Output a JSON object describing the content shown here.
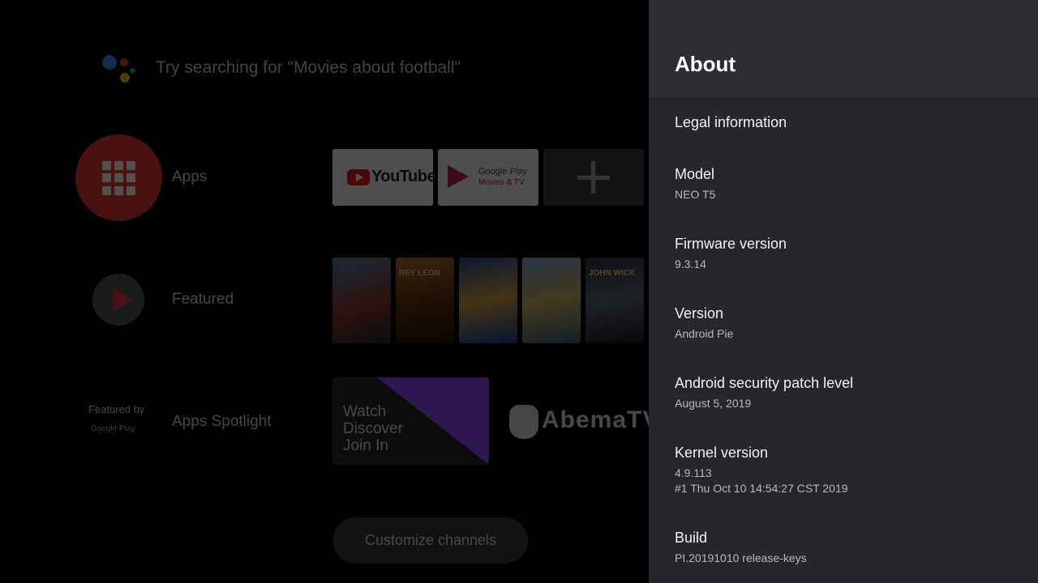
{
  "home": {
    "search_hint": "Try searching for \"Movies about football\"",
    "rows": {
      "apps_label": "Apps",
      "featured_label": "Featured",
      "spotlight_label": "Apps Spotlight",
      "featured_by": "Featured by",
      "featured_by_logo": "Google Play"
    },
    "apps": {
      "youtube": "YouTube",
      "play_movies_line1": "Google Play",
      "play_movies_line2": "Movies & TV"
    },
    "posters": [
      "",
      "REY LEÓN",
      "",
      "",
      "JOHN WICK"
    ],
    "twitch_text": "Watch\nDiscover\nJoin In",
    "abema": "AbemaTV",
    "customize": "Customize channels",
    "colors": {
      "apps_red": "#e53935",
      "twitch_purple": "#9146ff"
    }
  },
  "panel": {
    "title": "About",
    "items": [
      {
        "title": "Legal information",
        "sub": []
      },
      {
        "title": "Model",
        "sub": [
          "NEO T5"
        ]
      },
      {
        "title": "Firmware version",
        "sub": [
          "9.3.14"
        ]
      },
      {
        "title": "Version",
        "sub": [
          "Android Pie"
        ]
      },
      {
        "title": "Android security patch level",
        "sub": [
          "August 5, 2019"
        ]
      },
      {
        "title": "Kernel version",
        "sub": [
          "4.9.113",
          "#1 Thu Oct 10 14:54:27 CST 2019"
        ]
      },
      {
        "title": "Build",
        "sub": [
          "PI.20191010 release-keys"
        ]
      }
    ],
    "colors": {
      "background": "#25272c",
      "header": "#2c2e33"
    }
  }
}
